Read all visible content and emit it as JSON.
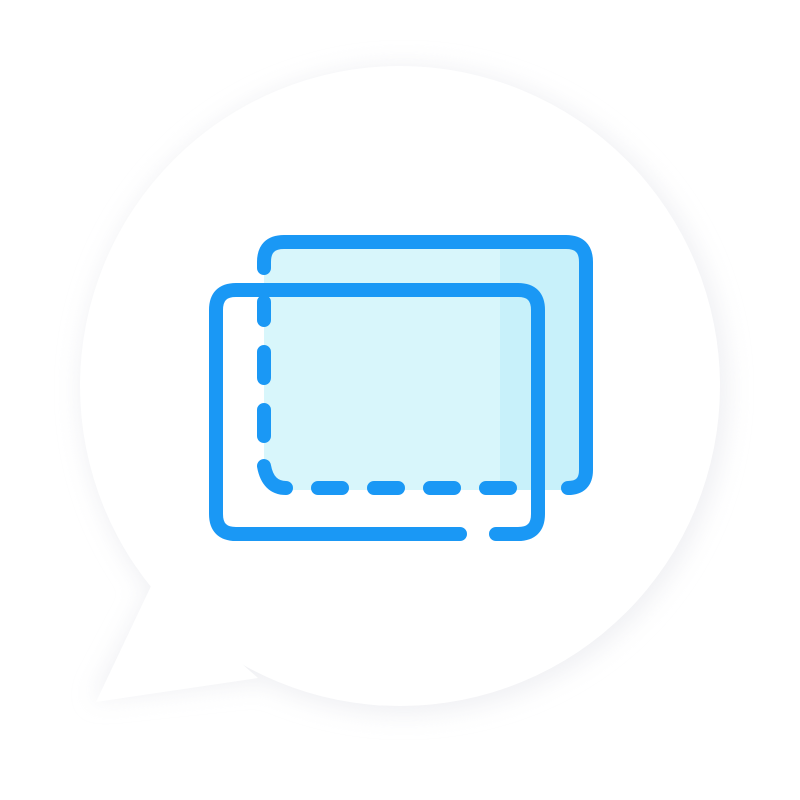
{
  "icon": {
    "name": "select-layers-icon",
    "colors": {
      "stroke": "#1a98f5",
      "fill_light": "#d8f6fb",
      "fill_shade": "#c8f1fa",
      "bubble": "#ffffff",
      "shadow": "#e6e7ec"
    }
  }
}
